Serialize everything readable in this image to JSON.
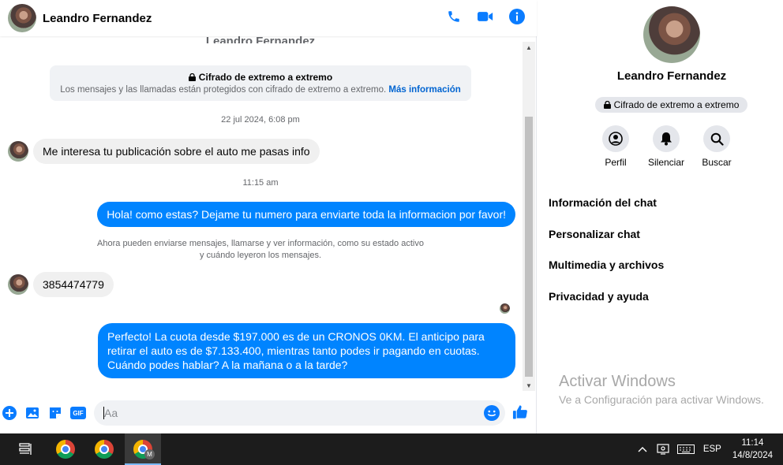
{
  "header": {
    "contact_name": "Leandro Fernandez",
    "ghost_name": "Leandro Fernandez"
  },
  "encryption": {
    "title": "Cifrado de extremo a extremo",
    "subtitle": "Los mensajes y las llamadas están protegidos con cifrado de extremo a extremo.",
    "link": "Más información"
  },
  "messages": {
    "ts1": "22 jul 2024, 6:08 pm",
    "msg1": "Me interesa tu publicación sobre el auto me pasas info",
    "ts2": "11:15 am",
    "msg2": "Hola! como estas? Dejame tu numero para enviarte toda la informacion por favor!",
    "system_note_line1": "Ahora pueden enviarse mensajes, llamarse y ver información, como su estado activo",
    "system_note_line2": "y cuándo leyeron los mensajes.",
    "msg3": "3854474779",
    "msg4": "Perfecto! La cuota desde $197.000 es de un CRONOS 0KM. El anticipo para retirar el auto es de $7.133.400, mientras tanto podes ir pagando en cuotas. Cuándo podes hablar? A la mañana o a la tarde?"
  },
  "composer": {
    "placeholder": "Aa",
    "gif_label": "GIF"
  },
  "side_panel": {
    "name": "Leandro Fernandez",
    "badge": "Cifrado de extremo a extremo",
    "actions": [
      {
        "label": "Perfil",
        "icon": "profile-icon"
      },
      {
        "label": "Silenciar",
        "icon": "bell-icon"
      },
      {
        "label": "Buscar",
        "icon": "search-icon"
      }
    ],
    "menu": [
      "Información del chat",
      "Personalizar chat",
      "Multimedia y archivos",
      "Privacidad y ayuda"
    ]
  },
  "watermark": {
    "title": "Activar Windows",
    "subtitle": "Ve a Configuración para activar Windows."
  },
  "taskbar": {
    "language": "ESP",
    "time": "11:14",
    "date": "14/8/2024",
    "badge_letter": "M"
  },
  "colors": {
    "accent": "#0084ff",
    "link": "#0064d1",
    "icon_blue": "#0a7cff"
  }
}
